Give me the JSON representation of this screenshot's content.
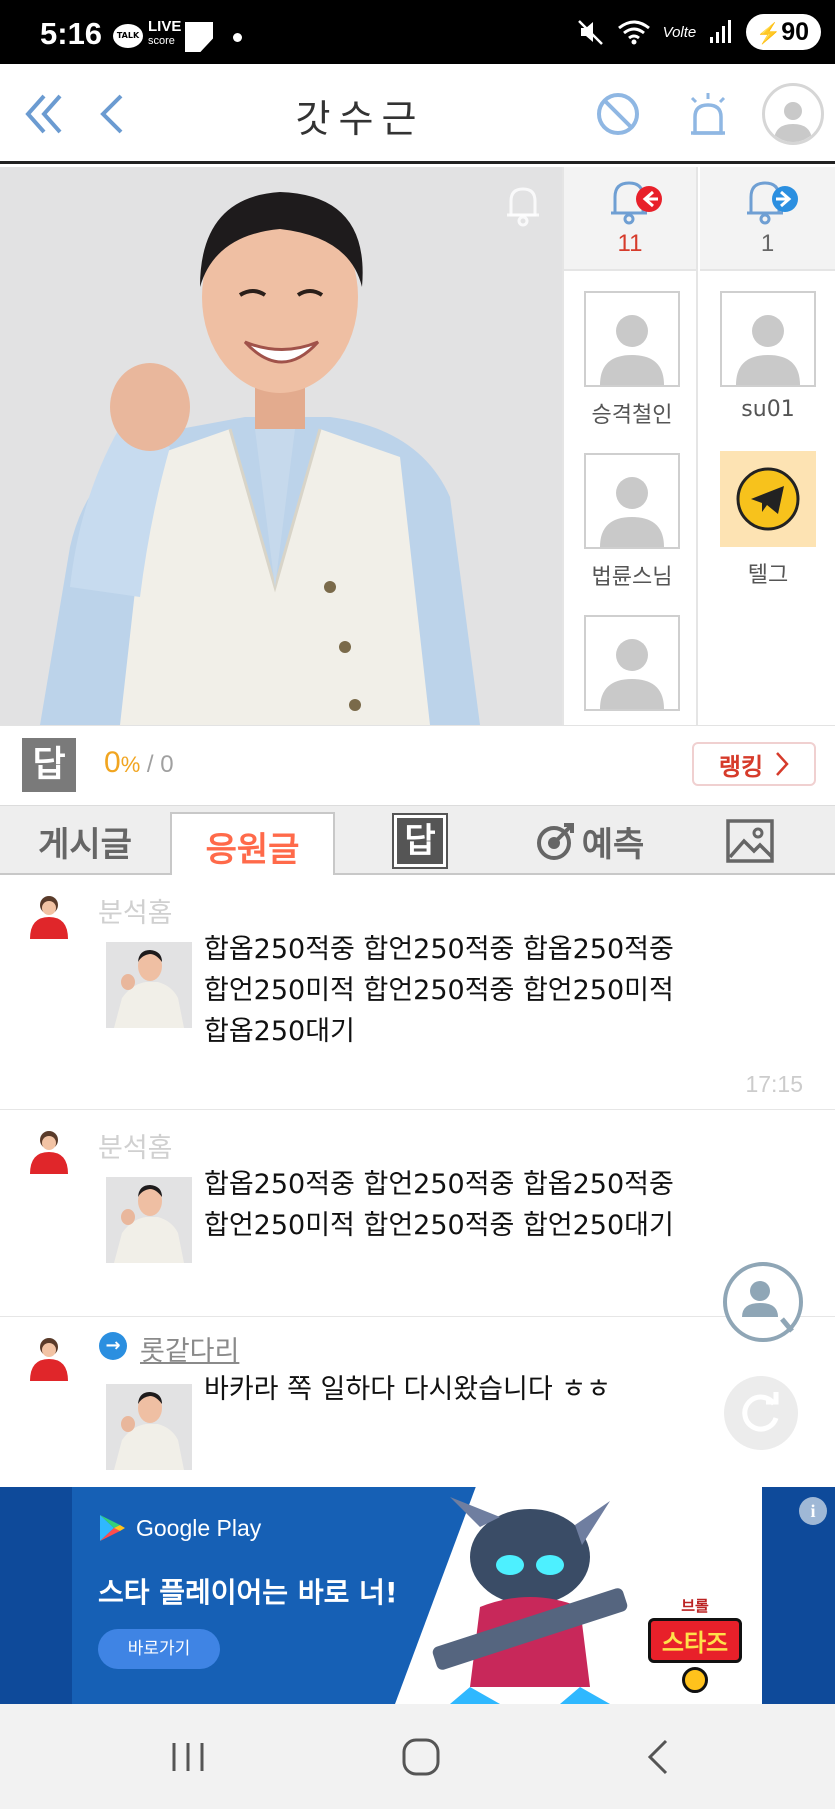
{
  "status_bar": {
    "time": "5:16",
    "talk_icon_text": "TALK",
    "live_icon_text": "LIVE",
    "score_icon_text": "score",
    "network_text": "Volte",
    "battery": "90"
  },
  "header": {
    "title": "갓수근"
  },
  "profile": {
    "received_count": "11",
    "sent_count": "1",
    "users_left": [
      "승격철인",
      "법륜스님",
      ""
    ],
    "users_right": [
      "su01",
      "텔그"
    ]
  },
  "answer_rate": {
    "icon_text": "답",
    "percent": "0",
    "percent_sign": "%",
    "rest": " / 0",
    "ranking_label": "랭킹"
  },
  "tabs": {
    "posts": "게시글",
    "cheers": "응원글",
    "answer_icon": "답",
    "predict": "예측"
  },
  "feed": [
    {
      "author": "분석홈",
      "lines": [
        "합옵250적중 합언250적중 합옵250적중",
        "합언250미적 합언250적중 합언250미적",
        "합옵250대기"
      ],
      "time": "17:15"
    },
    {
      "author": "분석홈",
      "lines": [
        "합옵250적중 합언250적중 합옵250적중",
        "합언250미적 합언250적중 합언250대기"
      ],
      "time": ""
    },
    {
      "author": "롯같다리",
      "lines": [
        "바카라 쪽 일하다 다시왔습니다 ㅎㅎ"
      ],
      "time": ""
    }
  ],
  "ad": {
    "store": "Google Play",
    "headline": "스타 플레이어는 바로 너!",
    "cta": "바로가기",
    "info": "i",
    "logo_top": "브롤",
    "logo_main": "스타즈"
  },
  "colors": {
    "accent_orange": "#ff6a4a",
    "red": "#d63b2b",
    "blue": "#2b8fe0",
    "rate_yellow": "#f1a520"
  }
}
